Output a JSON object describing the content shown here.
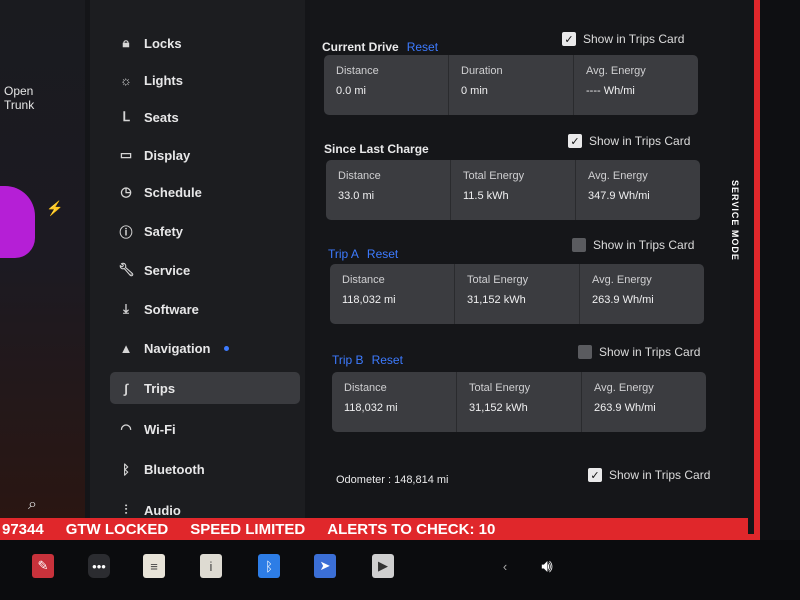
{
  "left_panel": {
    "open_trunk": "Open\nTrunk"
  },
  "menu": {
    "items": [
      {
        "label": "Locks",
        "icon": "lock-icon"
      },
      {
        "label": "Lights",
        "icon": "sun-icon"
      },
      {
        "label": "Seats",
        "icon": "seat-icon"
      },
      {
        "label": "Display",
        "icon": "display-icon"
      },
      {
        "label": "Schedule",
        "icon": "clock-icon"
      },
      {
        "label": "Safety",
        "icon": "info-icon"
      },
      {
        "label": "Service",
        "icon": "wrench-icon"
      },
      {
        "label": "Software",
        "icon": "download-icon"
      },
      {
        "label": "Navigation",
        "icon": "navigation-icon"
      },
      {
        "label": "Trips",
        "icon": "trips-icon"
      },
      {
        "label": "Wi-Fi",
        "icon": "wifi-icon"
      },
      {
        "label": "Bluetooth",
        "icon": "bluetooth-icon"
      },
      {
        "label": "Audio",
        "icon": "sliders-icon"
      }
    ],
    "active": "Trips"
  },
  "current_drive": {
    "title": "Current Drive",
    "reset": "Reset",
    "show_in_trips": "Show in Trips Card",
    "checked": true,
    "cells": [
      {
        "label": "Distance",
        "value": "0.0 mi"
      },
      {
        "label": "Duration",
        "value": "0 min"
      },
      {
        "label": "Avg. Energy",
        "value": "---- Wh/mi"
      }
    ]
  },
  "since_last_charge": {
    "title": "Since Last Charge",
    "show_in_trips": "Show in Trips Card",
    "checked": true,
    "cells": [
      {
        "label": "Distance",
        "value": "33.0 mi"
      },
      {
        "label": "Total Energy",
        "value": "11.5 kWh"
      },
      {
        "label": "Avg. Energy",
        "value": "347.9 Wh/mi"
      }
    ]
  },
  "trip_a": {
    "title": "Trip A",
    "reset": "Reset",
    "show_in_trips": "Show in Trips Card",
    "checked": false,
    "cells": [
      {
        "label": "Distance",
        "value": "118,032 mi"
      },
      {
        "label": "Total Energy",
        "value": "31,152 kWh"
      },
      {
        "label": "Avg. Energy",
        "value": "263.9 Wh/mi"
      }
    ]
  },
  "trip_b": {
    "title": "Trip B",
    "reset": "Reset",
    "show_in_trips": "Show in Trips Card",
    "checked": false,
    "cells": [
      {
        "label": "Distance",
        "value": "118,032 mi"
      },
      {
        "label": "Total Energy",
        "value": "31,152 kWh"
      },
      {
        "label": "Avg. Energy",
        "value": "263.9 Wh/mi"
      }
    ]
  },
  "odometer": {
    "text": "Odometer : 148,814 mi",
    "show_in_trips": "Show in Trips Card",
    "checked": true
  },
  "service_mode": "SERVICE MODE",
  "status_bar": {
    "id": "97344",
    "gtw": "GTW LOCKED",
    "speed": "SPEED LIMITED",
    "alerts": "ALERTS TO CHECK: 10"
  },
  "colors": {
    "accent_blue": "#3d7bff",
    "alert_red": "#e0272b",
    "card_bg": "#3b3c40"
  }
}
